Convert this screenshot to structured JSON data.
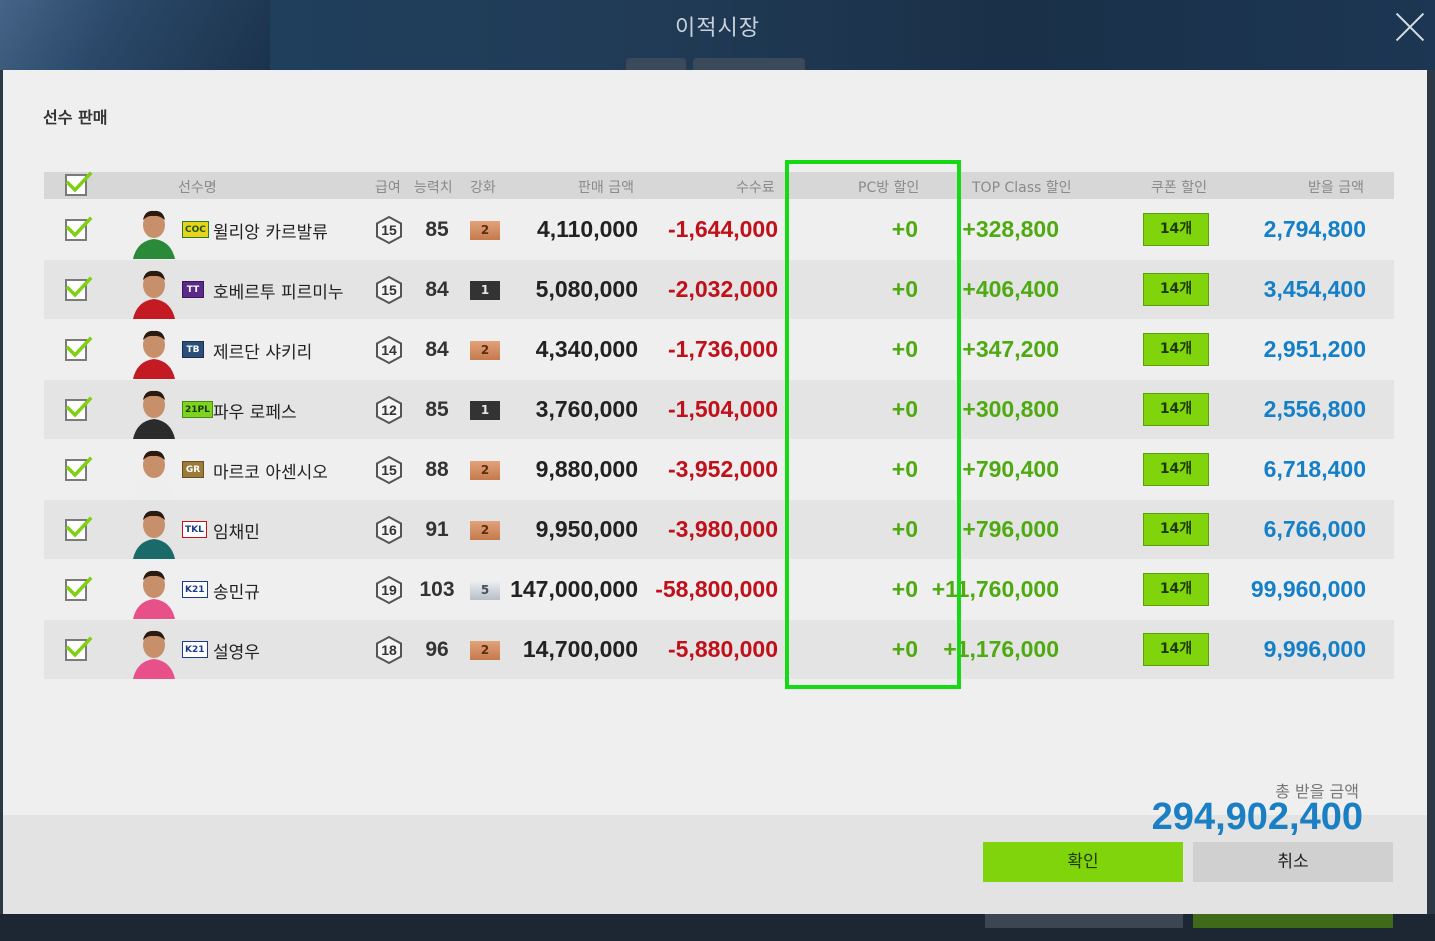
{
  "window": {
    "title": "이적시장"
  },
  "modal": {
    "title": "선수 판매",
    "columns": {
      "name": "선수명",
      "salary": "급여",
      "ovr": "능력치",
      "enhance": "강화",
      "sell_price": "판매 금액",
      "fee": "수수료",
      "pc_discount": "PC방 할인",
      "top_discount": "TOP Class 할인",
      "coupon_discount": "쿠폰 할인",
      "receive": "받을 금액"
    },
    "rows": [
      {
        "season": "COC",
        "name": "윌리앙 카르발류",
        "salary": "15",
        "ovr": "85",
        "enhance": "2",
        "enhance_tier": "bronze",
        "sell": "4,110,000",
        "fee": "-1,644,000",
        "pc": "+0",
        "top": "+328,800",
        "coupon": "14개",
        "receive": "2,794,800"
      },
      {
        "season": "TT",
        "name": "호베르투 피르미누",
        "salary": "15",
        "ovr": "84",
        "enhance": "1",
        "enhance_tier": "black",
        "sell": "5,080,000",
        "fee": "-2,032,000",
        "pc": "+0",
        "top": "+406,400",
        "coupon": "14개",
        "receive": "3,454,400"
      },
      {
        "season": "TB",
        "name": "제르단 샤키리",
        "salary": "14",
        "ovr": "84",
        "enhance": "2",
        "enhance_tier": "bronze",
        "sell": "4,340,000",
        "fee": "-1,736,000",
        "pc": "+0",
        "top": "+347,200",
        "coupon": "14개",
        "receive": "2,951,200"
      },
      {
        "season": "21PL",
        "name": "파우 로페스",
        "salary": "12",
        "ovr": "85",
        "enhance": "1",
        "enhance_tier": "black",
        "sell": "3,760,000",
        "fee": "-1,504,000",
        "pc": "+0",
        "top": "+300,800",
        "coupon": "14개",
        "receive": "2,556,800"
      },
      {
        "season": "GR",
        "name": "마르코 아센시오",
        "salary": "15",
        "ovr": "88",
        "enhance": "2",
        "enhance_tier": "bronze",
        "sell": "9,880,000",
        "fee": "-3,952,000",
        "pc": "+0",
        "top": "+790,400",
        "coupon": "14개",
        "receive": "6,718,400"
      },
      {
        "season": "TKL",
        "name": "임채민",
        "salary": "16",
        "ovr": "91",
        "enhance": "2",
        "enhance_tier": "bronze",
        "sell": "9,950,000",
        "fee": "-3,980,000",
        "pc": "+0",
        "top": "+796,000",
        "coupon": "14개",
        "receive": "6,766,000"
      },
      {
        "season": "K21",
        "name": "송민규",
        "salary": "19",
        "ovr": "103",
        "enhance": "5",
        "enhance_tier": "silver",
        "sell": "147,000,000",
        "fee": "-58,800,000",
        "pc": "+0",
        "top": "+11,760,000",
        "coupon": "14개",
        "receive": "99,960,000"
      },
      {
        "season": "K21",
        "name": "설영우",
        "salary": "18",
        "ovr": "96",
        "enhance": "2",
        "enhance_tier": "bronze",
        "sell": "14,700,000",
        "fee": "-5,880,000",
        "pc": "+0",
        "top": "+1,176,000",
        "coupon": "14개",
        "receive": "9,996,000"
      }
    ],
    "total_label": "총 받을 금액",
    "total_value": "294,902,400",
    "confirm_label": "확인",
    "cancel_label": "취소"
  },
  "colors": {
    "accent_green": "#80d40c",
    "fee_red": "#c0101a",
    "receive_blue": "#1580c8",
    "highlight": "#14d914"
  }
}
